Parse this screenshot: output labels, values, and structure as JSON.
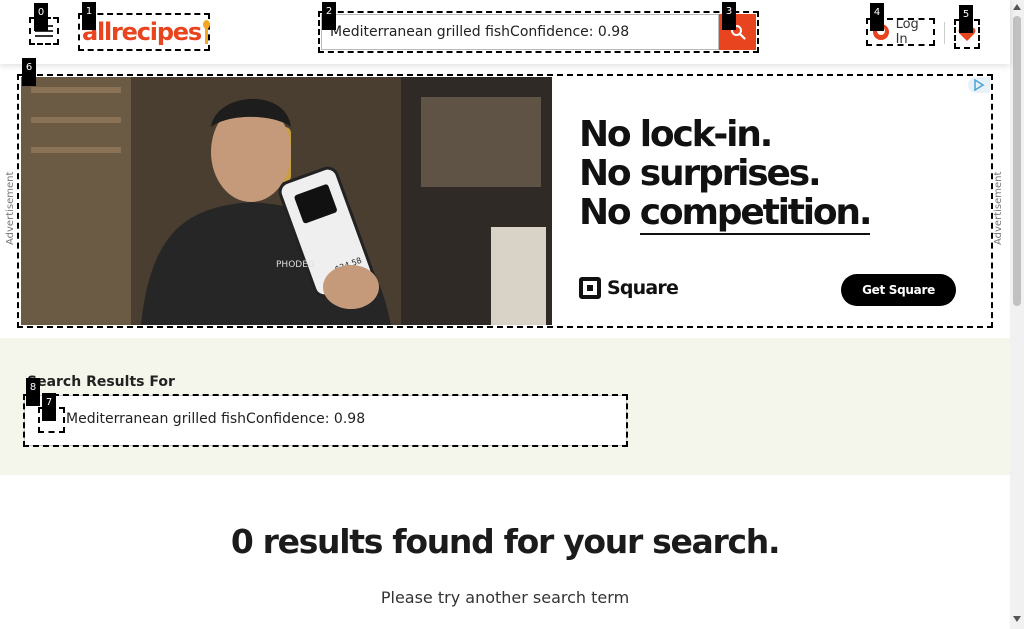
{
  "header": {
    "logo_text": "allrecipes",
    "search": {
      "value": "Mediterranean grilled fishConfidence: 0.98"
    },
    "login_label": "Log In"
  },
  "markers": [
    "0",
    "1",
    "2",
    "3",
    "4",
    "5",
    "6",
    "7",
    "8"
  ],
  "ad": {
    "side_label": "Advertisement",
    "headline_lines": [
      "No lock-in.",
      "No surprises.",
      "No "
    ],
    "headline_emphasis": "competition.",
    "brand": "Square",
    "cta_label": "Get Square",
    "photo_texts": {
      "phone_amount": "$24.58",
      "apron_text": "PHODEG"
    }
  },
  "results": {
    "heading": "Search Results For",
    "query_text": "Mediterranean grilled fishConfidence: 0.98",
    "none_title": "0 results found for your search.",
    "try_again": "Please try another search term"
  },
  "colors": {
    "brand_orange": "#e8441f",
    "band_bg": "#f4f6ec",
    "spoon_yellow": "#f5a623"
  },
  "icons": [
    "hamburger-menu-icon",
    "search-icon",
    "user-icon",
    "heart-icon",
    "adchoices-icon",
    "square-logo-icon",
    "checkbox-icon"
  ]
}
